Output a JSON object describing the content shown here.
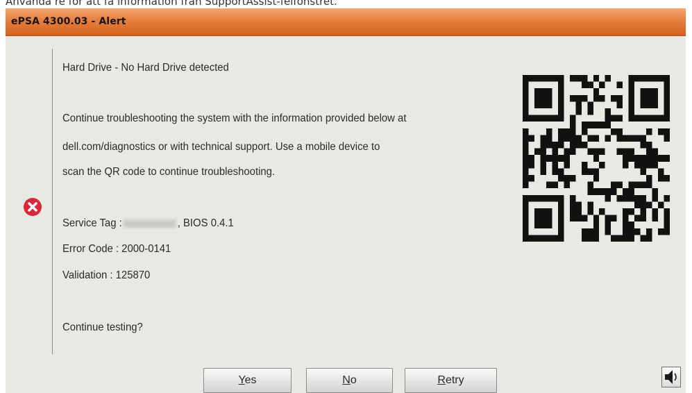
{
  "caption": "Använda re för att fa information fran SupportAssist-felfonstret.",
  "window": {
    "title": "ePSA 4300.03 - Alert"
  },
  "message": {
    "heading": "Hard Drive - No Hard Drive detected",
    "body_lines": [
      "Continue troubleshooting the system with the information provided below at",
      "dell.com/diagnostics or with technical support.  Use a mobile device to",
      "scan the QR code to continue troubleshooting."
    ],
    "service_tag_label": "Service Tag :",
    "bios": ", BIOS 0.4.1",
    "error_code": "Error Code : 2000-0141",
    "validation": "Validation : 125870",
    "prompt": "Continue testing?"
  },
  "icons": {
    "error": "error-circle-x-icon",
    "qr": "qr-code",
    "speaker": "speaker-icon"
  },
  "buttons": {
    "yes": {
      "hotkey": "Y",
      "rest": "es"
    },
    "no": {
      "hotkey": "N",
      "rest": "o"
    },
    "retry": {
      "hotkey": "R",
      "rest": "etry"
    }
  },
  "colors": {
    "titlebar": "#e57e3c",
    "background": "#e9e9e4",
    "error": "#d8283a"
  }
}
